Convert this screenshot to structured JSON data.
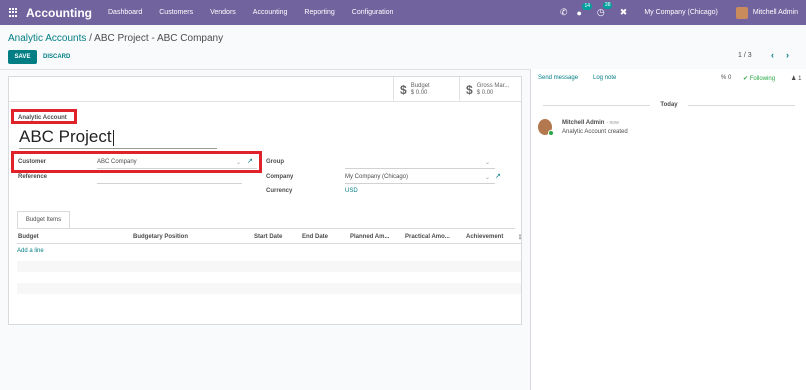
{
  "navbar": {
    "brand": "Accounting",
    "menu": [
      "Dashboard",
      "Customers",
      "Vendors",
      "Accounting",
      "Reporting",
      "Configuration"
    ],
    "messages_badge": "14",
    "activities_badge": "38",
    "company": "My Company (Chicago)",
    "user": "Mitchell Admin"
  },
  "breadcrumb": {
    "parent": "Analytic Accounts",
    "separator": " / ",
    "current": "ABC Project - ABC Company"
  },
  "actions": {
    "save": "SAVE",
    "discard": "DISCARD"
  },
  "pager": {
    "value": "1 / 3"
  },
  "stat_buttons": [
    {
      "label": "Budget",
      "value": "$ 0.00"
    },
    {
      "label": "Gross Mar...",
      "value": "$ 0.00"
    }
  ],
  "form": {
    "name_label": "Analytic Account",
    "name_value": "ABC Project",
    "customer_label": "Customer",
    "customer_value": "ABC Company",
    "reference_label": "Reference",
    "group_label": "Group",
    "company_label": "Company",
    "company_value": "My Company (Chicago)",
    "currency_label": "Currency",
    "currency_value": "USD"
  },
  "tab": {
    "label": "Budget Items"
  },
  "table": {
    "columns": [
      "Budget",
      "Budgetary Position",
      "Start Date",
      "End Date",
      "Planned Am...",
      "Practical Amo...",
      "Achievement"
    ],
    "add_line": "Add a line"
  },
  "chatter": {
    "send_message": "Send message",
    "log_note": "Log note",
    "attachments": "0",
    "following": "Following",
    "followers": "1",
    "date_separator": "Today",
    "message_author": "Mitchell Admin",
    "message_time": "- now",
    "message_body": "Analytic Account created"
  },
  "colors": {
    "navbar": "#71639e",
    "accent": "#017e84",
    "highlight": "#e0222a"
  }
}
